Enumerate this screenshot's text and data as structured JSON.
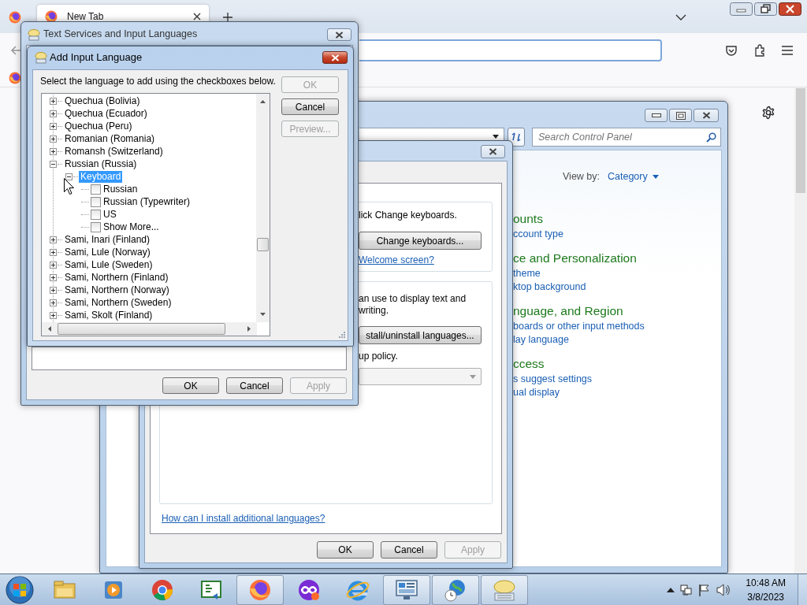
{
  "browser": {
    "tabs": [
      {
        "label": "New Tab",
        "selected": true
      }
    ]
  },
  "control_panel": {
    "search": {
      "placeholder": "Search Control Panel"
    },
    "view_by_label": "View by:",
    "view_by_value": "Category",
    "categories": [
      {
        "heading": "ounts",
        "links": [
          "ccount type"
        ]
      },
      {
        "heading": "ce and Personalization",
        "links": [
          "theme",
          "ktop background"
        ]
      },
      {
        "heading": "nguage, and Region",
        "links": [
          "boards or other input methods",
          "lay language"
        ]
      },
      {
        "heading": "ccess",
        "links": [
          "s suggest settings",
          "ual display"
        ]
      }
    ]
  },
  "region_dialog": {
    "keyboards_text": "lick Change keyboards.",
    "change_keyboards_button": "Change keyboards...",
    "welcome_link": "Welcome screen?",
    "display_text": [
      "an use to display text and",
      "writing."
    ],
    "install_button": "stall/uninstall languages...",
    "policy_text": "up policy.",
    "help_link": "How can I install additional languages?",
    "buttons": [
      {
        "label": "OK",
        "disabled": false
      },
      {
        "label": "Cancel",
        "disabled": false
      },
      {
        "label": "Apply",
        "disabled": true
      }
    ]
  },
  "text_services": {
    "title": "Text Services and Input Languages",
    "buttons": [
      {
        "label": "OK",
        "disabled": false
      },
      {
        "label": "Cancel",
        "disabled": false
      },
      {
        "label": "Apply",
        "disabled": true
      }
    ]
  },
  "add_language": {
    "title": "Add Input Language",
    "instruction": "Select the language to add using the checkboxes below.",
    "tree": [
      {
        "kind": "language",
        "label": "Quechua (Bolivia)",
        "expanded": false,
        "selected": false
      },
      {
        "kind": "language",
        "label": "Quechua (Ecuador)",
        "expanded": false,
        "selected": false
      },
      {
        "kind": "language",
        "label": "Quechua (Peru)",
        "expanded": false,
        "selected": false
      },
      {
        "kind": "language",
        "label": "Romanian (Romania)",
        "expanded": false,
        "selected": false
      },
      {
        "kind": "language",
        "label": "Romansh (Switzerland)",
        "expanded": false,
        "selected": false
      },
      {
        "kind": "language",
        "label": "Russian (Russia)",
        "expanded": true,
        "selected": false,
        "children": [
          {
            "kind": "group",
            "label": "Keyboard",
            "expanded": true,
            "selected": true,
            "children": [
              {
                "kind": "option",
                "label": "Russian",
                "checked": false,
                "selected": false
              },
              {
                "kind": "option",
                "label": "Russian (Typewriter)",
                "checked": false,
                "selected": false
              },
              {
                "kind": "option",
                "label": "US",
                "checked": false,
                "selected": false
              },
              {
                "kind": "option",
                "label": "Show More...",
                "checked": false,
                "selected": false
              }
            ]
          }
        ]
      },
      {
        "kind": "language",
        "label": "Sami, Inari (Finland)",
        "expanded": false,
        "selected": false
      },
      {
        "kind": "language",
        "label": "Sami, Lule (Norway)",
        "expanded": false,
        "selected": false
      },
      {
        "kind": "language",
        "label": "Sami, Lule (Sweden)",
        "expanded": false,
        "selected": false
      },
      {
        "kind": "language",
        "label": "Sami, Northern (Finland)",
        "expanded": false,
        "selected": false
      },
      {
        "kind": "language",
        "label": "Sami, Northern (Norway)",
        "expanded": false,
        "selected": false
      },
      {
        "kind": "language",
        "label": "Sami, Northern (Sweden)",
        "expanded": false,
        "selected": false
      },
      {
        "kind": "language",
        "label": "Sami, Skolt (Finland)",
        "expanded": false,
        "selected": false
      }
    ],
    "buttons": [
      {
        "label": "OK",
        "disabled": true
      },
      {
        "label": "Cancel",
        "disabled": false
      },
      {
        "label": "Preview...",
        "disabled": true
      }
    ]
  },
  "taskbar": {
    "apps": [
      {
        "kind": "folder",
        "active": false
      },
      {
        "kind": "player",
        "active": false
      },
      {
        "kind": "roundbrowser",
        "active": false
      },
      {
        "kind": "code",
        "active": false
      },
      {
        "kind": "firefox",
        "active": true
      },
      {
        "kind": "mask",
        "active": false
      },
      {
        "kind": "ie",
        "active": false
      },
      {
        "kind": "controlpanel",
        "active": true
      },
      {
        "kind": "globe",
        "active": true
      },
      {
        "kind": "keyboard",
        "active": true
      }
    ],
    "clock_time": "10:48 AM",
    "clock_date": "3/8/2023"
  }
}
